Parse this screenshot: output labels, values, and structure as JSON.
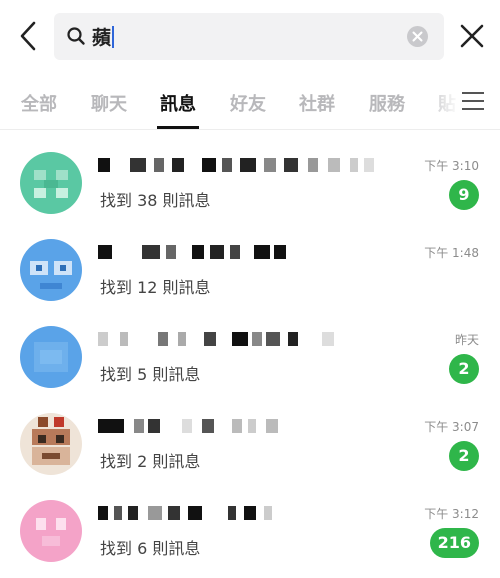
{
  "search": {
    "query": "蘋"
  },
  "tabs": [
    {
      "label": "全部",
      "active": false
    },
    {
      "label": "聊天",
      "active": false
    },
    {
      "label": "訊息",
      "active": true
    },
    {
      "label": "好友",
      "active": false
    },
    {
      "label": "社群",
      "active": false
    },
    {
      "label": "服務",
      "active": false
    },
    {
      "label": "貼",
      "active": false
    }
  ],
  "results": [
    {
      "found": "找到 38 則訊息",
      "time": "下午 3:10",
      "count": "9",
      "avatar_color": "#5ac8a3"
    },
    {
      "found": "找到 12 則訊息",
      "time": "下午 1:48",
      "count": "",
      "avatar_color": "#5aa3e8"
    },
    {
      "found": "找到 5 則訊息",
      "time": "昨天",
      "count": "2",
      "avatar_color": "#5aa3e8"
    },
    {
      "found": "找到 2 則訊息",
      "time": "下午 3:07",
      "count": "2",
      "avatar_color": "#b87a5a"
    },
    {
      "found": "找到 6 則訊息",
      "time": "下午 3:12",
      "count": "216",
      "avatar_color": "#f4a3c8"
    }
  ],
  "colors": {
    "badge": "#2fb64a",
    "caret": "#2f66d9",
    "tab_active": "#111111",
    "tab_inactive": "#b8b8bb"
  },
  "icons": {
    "back": "chevron-left-icon",
    "search": "search-icon",
    "clear": "clear-icon",
    "close": "close-icon",
    "menu": "hamburger-menu-icon"
  }
}
